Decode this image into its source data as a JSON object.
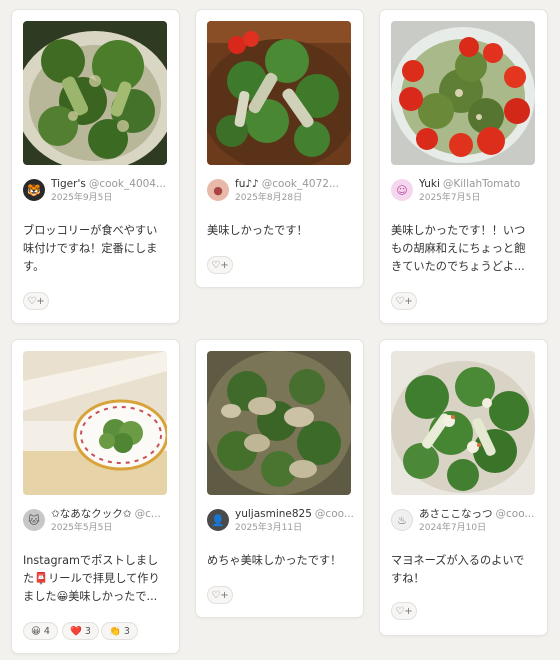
{
  "cards": [
    {
      "name": "Tiger's",
      "handle": "@cook_4004...",
      "date": "2025年9月5日",
      "comment_lines": [
        "ブロッコリーが食べやすい",
        "味付けですね！定番にしま",
        "す。"
      ],
      "avatar_icon": "tiger-icon"
    },
    {
      "name": "fu♪♪",
      "handle": "@cook_4072...",
      "date": "2025年8月28日",
      "comment_lines": [
        "美味しかったです！"
      ],
      "avatar_icon": "user-photo-icon"
    },
    {
      "name": "Yuki",
      "handle": "@KillahTomato",
      "date": "2025年7月5日",
      "comment_lines": [
        "美味しかったです！！いつ",
        "もの胡麻和えにちょっと飽",
        "きていたのでちょうどよ..."
      ],
      "avatar_icon": "character-icon"
    },
    {
      "name": "✩なあなクック✩",
      "handle": "@c...",
      "date": "2025年5月5日",
      "comment_lines": [
        "Instagramでポストしまし",
        "た📮リールで拝見して作り",
        "ました😀美味しかったで..."
      ],
      "avatar_icon": "cat-icon",
      "reactions": [
        {
          "emoji": "😀",
          "count": "4"
        },
        {
          "emoji": "❤️",
          "count": "3"
        },
        {
          "emoji": "👏",
          "count": "3"
        }
      ]
    },
    {
      "name": "yuljasmine825",
      "handle": "@coo...",
      "date": "2025年3月11日",
      "comment_lines": [
        "めちゃ美味しかったです！"
      ],
      "avatar_icon": "person-icon"
    },
    {
      "name": "あさここなっつ",
      "handle": "@coo...",
      "date": "2024年7月10日",
      "comment_lines": [
        "マヨネーズが入るのよいで",
        "すね！"
      ],
      "avatar_icon": "chef-hat-icon"
    }
  ],
  "reaction_button_icon": "heart-plus-icon",
  "reaction_button_symbol": "♡+"
}
